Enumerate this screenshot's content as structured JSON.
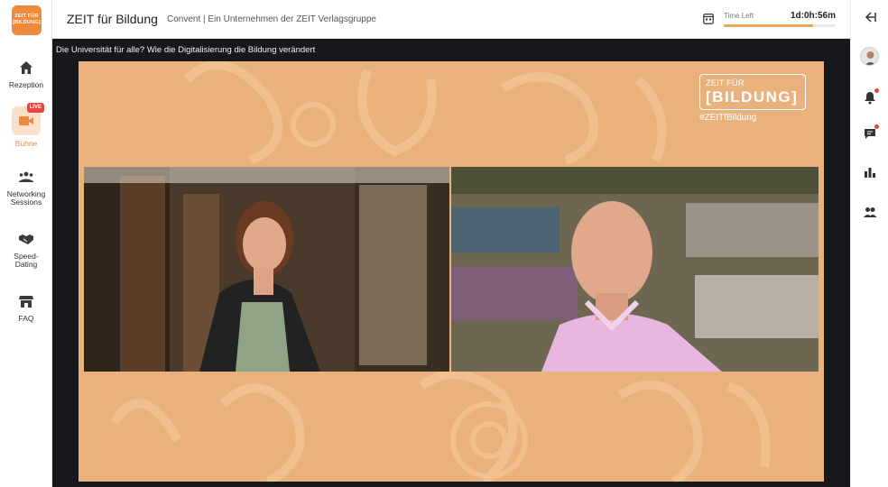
{
  "sidebar": {
    "logo_line1": "ZEIT FÜR",
    "logo_line2": "[BILDUNG]",
    "items": [
      {
        "label": "Rezeption",
        "icon": "home-icon"
      },
      {
        "label": "Bühne",
        "icon": "stage-camera-icon",
        "badge": "LIVE"
      },
      {
        "label": "Networking Sessions",
        "icon": "networking-icon"
      },
      {
        "label": "Speed-Dating",
        "icon": "handshake-icon"
      },
      {
        "label": "FAQ",
        "icon": "booth-icon"
      }
    ]
  },
  "header": {
    "title": "ZEIT für Bildung",
    "subtitle": "Convent | Ein Unternehmen der ZEIT Verlagsgruppe",
    "time_left_label": "Time Left",
    "time_left_value": "1d:0h:56m",
    "time_progress": 0.8
  },
  "stage": {
    "session_title": "Die Universität für alle? Wie die Digitalisierung die Bildung verändert",
    "brand_top": "ZEIT FÜR",
    "brand_main": "[BILDUNG]",
    "brand_hashtag": "#ZEITfBildung"
  },
  "rightrail": {
    "icons": [
      "collapse-icon",
      "avatar",
      "bell-icon",
      "chat-icon",
      "poll-icon",
      "people-icon"
    ]
  },
  "colors": {
    "accent": "#ef8a3c",
    "stage_bg": "#16181b",
    "frame_bg": "#e9b27d",
    "live": "#e8453c"
  }
}
